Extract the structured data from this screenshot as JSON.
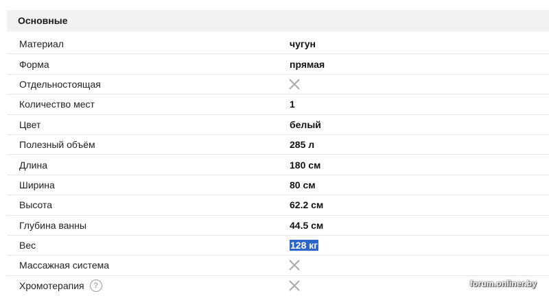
{
  "section": {
    "title": "Основные"
  },
  "rows": [
    {
      "label": "Материал",
      "value": "чугун"
    },
    {
      "label": "Форма",
      "value": "прямая"
    },
    {
      "label": "Отдельностоящая",
      "value": null,
      "icon": "x-icon"
    },
    {
      "label": "Количество мест",
      "value": "1"
    },
    {
      "label": "Цвет",
      "value": "белый"
    },
    {
      "label": "Полезный объём",
      "value": "285 л"
    },
    {
      "label": "Длина",
      "value": "180 см"
    },
    {
      "label": "Ширина",
      "value": "80 см"
    },
    {
      "label": "Высота",
      "value": "62.2 см"
    },
    {
      "label": "Глубина ванны",
      "value": "44.5 см"
    },
    {
      "label": "Вес",
      "value": "128 кг",
      "selected": true
    },
    {
      "label": "Массажная система",
      "value": null,
      "icon": "x-icon"
    },
    {
      "label": "Хромотерапия",
      "value": null,
      "icon": "x-icon",
      "help_icon": "question-circle-icon",
      "help_glyph": "?"
    }
  ],
  "watermark": "forum.onliner.by",
  "colors": {
    "header_bg": "#f2f2f2",
    "row_divider": "#e6e6e6",
    "selection": "#2f64c8",
    "x_icon": "#a9a9a9"
  }
}
